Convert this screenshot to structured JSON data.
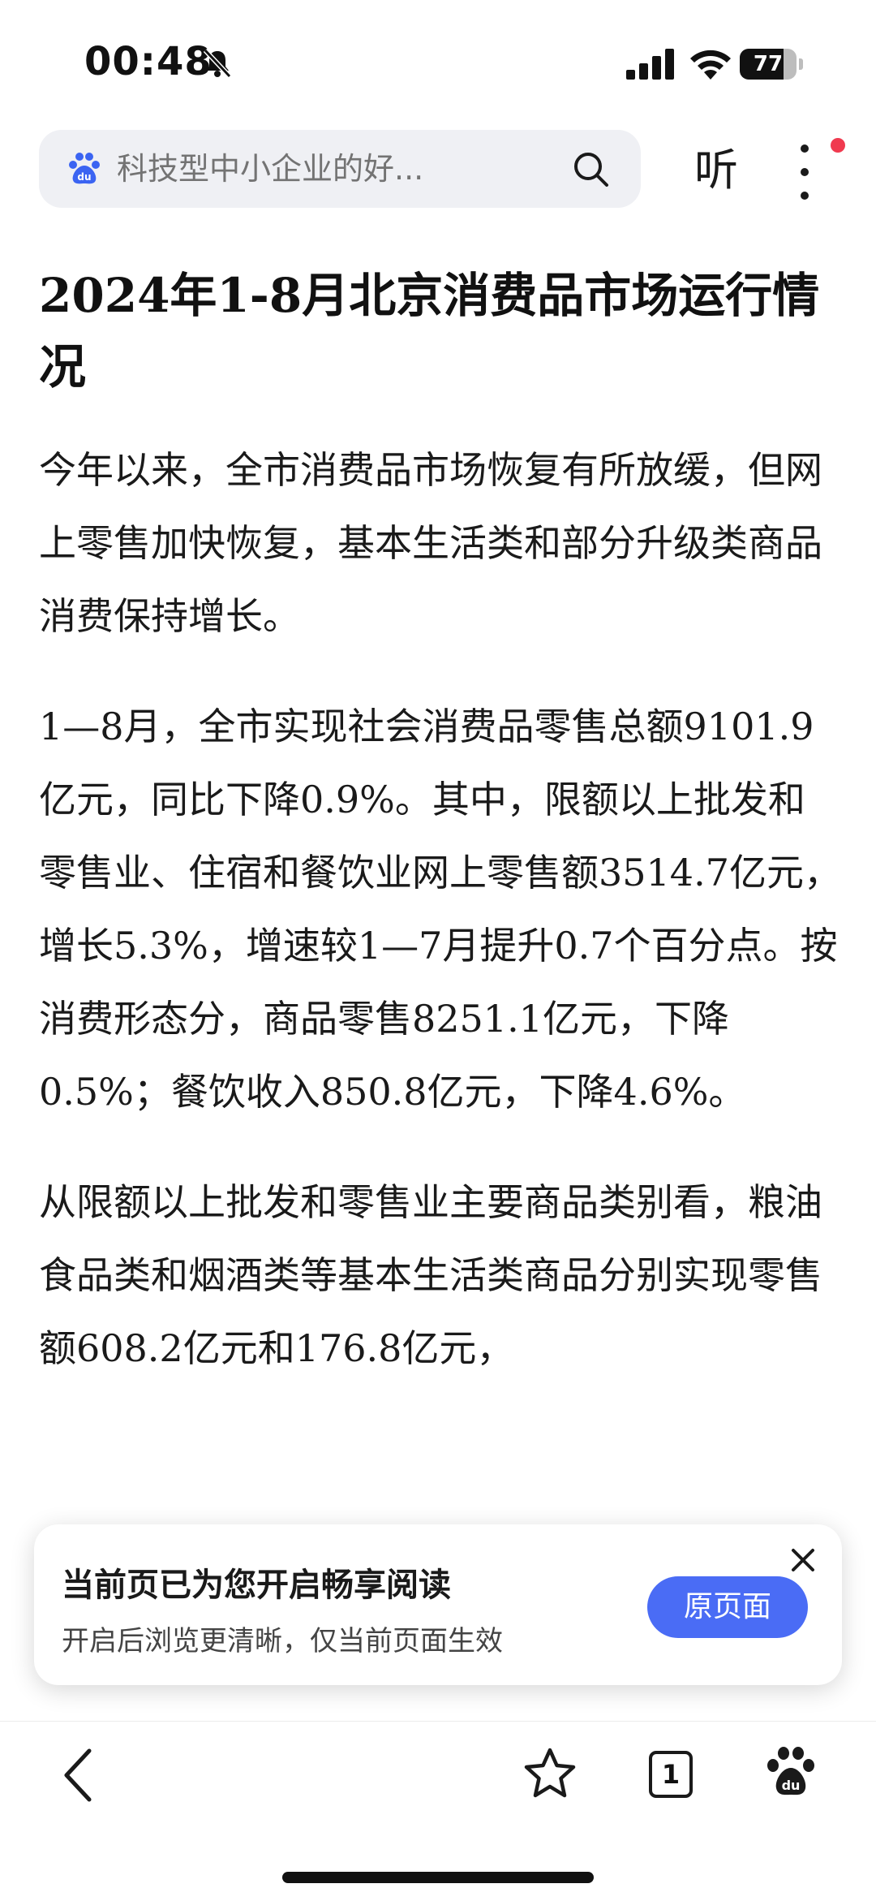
{
  "status_bar": {
    "time": "00:48",
    "battery_level": "77",
    "icons": [
      "bell-muted-icon",
      "cellular-signal-icon",
      "wifi-icon",
      "battery-icon"
    ]
  },
  "search": {
    "query": "科技型中小企业的好...",
    "listen_label": "听",
    "icons": [
      "baidu-logo-icon",
      "search-icon",
      "more-vertical-icon"
    ],
    "notification_color": "#f03a4f"
  },
  "article": {
    "title": "2024年1-8月北京消费品市场运行情况",
    "paragraphs": [
      " 今年以来，全市消费品市场恢复有所放缓，但网上零售加快恢复，基本生活类和部分升级类商品消费保持增长。",
      "1—8月，全市实现社会消费品零售总额9101.9亿元，同比下降0.9%。其中，限额以上批发和零售业、住宿和餐饮业网上零售额3514.7亿元，增长5.3%，增速较1—7月提升0.7个百分点。按消费形态分，商品零售8251.1亿元，下降0.5%；餐饮收入850.8亿元，下降4.6%。",
      "从限额以上批发和零售业主要商品类别看，粮油食品类和烟酒类等基本生活类商品分别实现零售额608.2亿元和176.8亿元，"
    ]
  },
  "banner": {
    "heading": "当前页已为您开启畅享阅读",
    "subtext": "开启后浏览更清晰，仅当前页面生效",
    "button_label": "原页面",
    "button_color": "#4a6cf5"
  },
  "bottom_nav": {
    "tab_count": "1",
    "icons": [
      "back-icon",
      "star-icon",
      "tabs-icon",
      "baidu-paw-icon"
    ]
  }
}
